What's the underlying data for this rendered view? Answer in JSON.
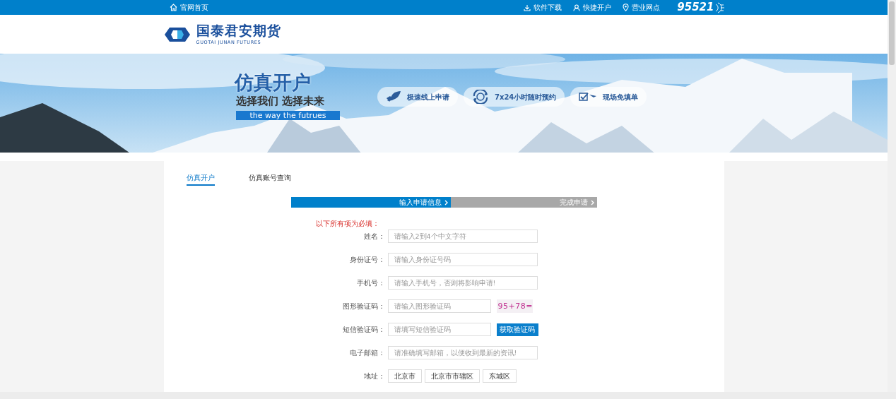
{
  "top_bar": {
    "home_link": "官网首页",
    "links": [
      {
        "label": "软件下载"
      },
      {
        "label": "快捷开户"
      },
      {
        "label": "营业网点"
      }
    ],
    "hotline": "95521"
  },
  "logo": {
    "name": "国泰君安期货",
    "subtitle": "GUOTAI JUNAN FUTURES"
  },
  "banner": {
    "title": "仿真开户",
    "slogan": "选择我们 选择未来",
    "tagline": "the way the futrues",
    "features": [
      {
        "label": "极速线上申请"
      },
      {
        "label": "7x24小时随时预约"
      },
      {
        "label": "现场免填单"
      }
    ]
  },
  "tabs": [
    {
      "label": "仿真开户",
      "selected": true
    },
    {
      "label": "仿真账号查询",
      "selected": false
    }
  ],
  "steps": [
    {
      "label": "输入申请信息",
      "selected": true
    },
    {
      "label": "完成申请",
      "selected": false
    }
  ],
  "required_note": "以下所有项为必填：",
  "fields": [
    {
      "kind": "text",
      "label": "姓名：",
      "placeholder": "请输入2到4个中文字符"
    },
    {
      "kind": "text",
      "label": "身份证号：",
      "placeholder": "请输入身份证号码"
    },
    {
      "kind": "text",
      "label": "手机号：",
      "placeholder": "请输入手机号，否则将影响申请!"
    },
    {
      "kind": "captcha",
      "label": "图形验证码：",
      "placeholder": "请输入图形验证码",
      "captcha": "95+78="
    },
    {
      "kind": "sms",
      "label": "短信验证码：",
      "placeholder": "请填写短信验证码",
      "button": "获取验证码"
    },
    {
      "kind": "text",
      "label": "电子邮箱：",
      "placeholder": "请准确填写邮箱，以便收到最新的资讯!"
    },
    {
      "kind": "selects",
      "label": "地址：",
      "values": [
        "北京市",
        "北京市市辖区",
        "东城区"
      ]
    }
  ]
}
